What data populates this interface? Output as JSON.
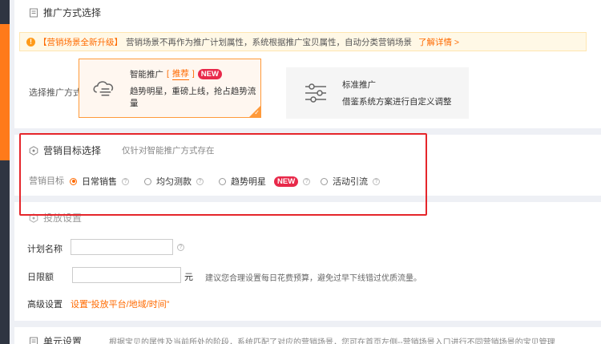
{
  "section1": {
    "title": "推广方式选择",
    "notice": {
      "tag": "【营销场景全新升级】",
      "text": "营销场景不再作为推广计划属性，系统根据推广宝贝属性，自动分类营销场景",
      "link": "了解详情 >"
    },
    "choose_label": "选择推广方式：",
    "smart": {
      "title": "智能推广",
      "recommend": "推荐",
      "badge": "NEW",
      "desc": "趋势明星，重磅上线，抢占趋势流量"
    },
    "standard": {
      "title": "标准推广",
      "desc": "借鉴系统方案进行自定义调整"
    }
  },
  "section2": {
    "title": "营销目标选择",
    "hint": "仅针对智能推广方式存在",
    "goal_label": "营销目标",
    "options": [
      {
        "label": "日常销售",
        "selected": true
      },
      {
        "label": "均匀测款",
        "selected": false
      },
      {
        "label": "趋势明星",
        "selected": false,
        "badge": "NEW"
      },
      {
        "label": "活动引流",
        "selected": false
      }
    ]
  },
  "section3": {
    "title": "投放设置",
    "plan_name_label": "计划名称",
    "plan_name_value": "",
    "daily_budget_label": "日限额",
    "daily_budget_value": "",
    "budget_unit": "元",
    "budget_hint": "建议您合理设置每日花费预算，避免过早下线错过优质流量。",
    "advanced_label": "高级设置",
    "advanced_link": "设置“投放平台/地域/时间”"
  },
  "section4": {
    "title": "单元设置",
    "hint": "根据宝贝的属性及当前所处的阶段，系统匹配了对应的营销场景，您可在首页左侧--营销场景入口进行不同营销场景的宝贝管理"
  },
  "colors": {
    "accent": "#ff6a00",
    "highlight_box": "#e5262b",
    "new_badge": "#e8294a"
  }
}
